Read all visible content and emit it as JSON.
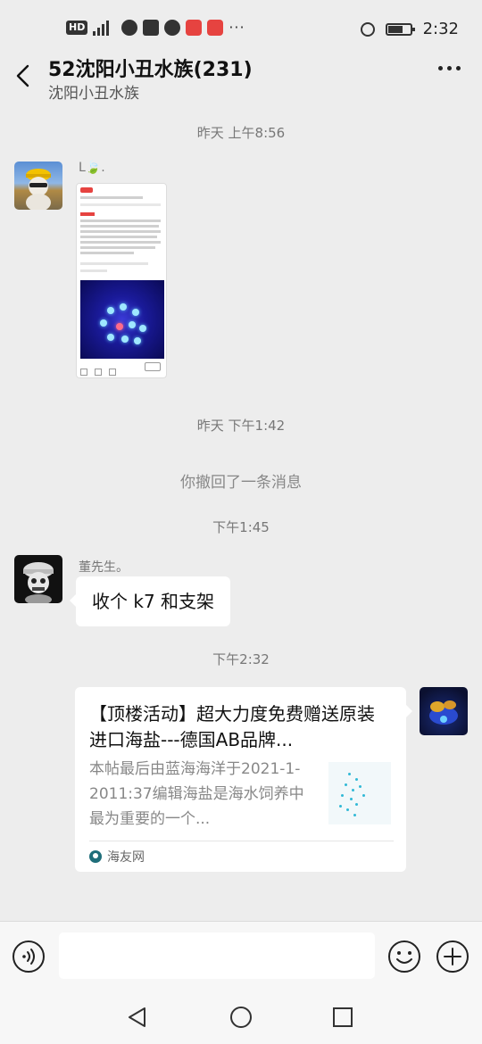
{
  "status_bar": {
    "time": "2:32",
    "network_label": "HD",
    "network_type": "4G"
  },
  "header": {
    "title": "52沈阳小丑水族(231)",
    "subtitle": "沈阳小丑水族"
  },
  "messages": {
    "time1": "昨天 上午8:56",
    "sender1": "L🍃.",
    "time2": "昨天 下午1:42",
    "recall": "你撤回了一条消息",
    "time3": "下午1:45",
    "sender2": "董先生。",
    "text2": "收个 k7 和支架",
    "time4": "下午2:32",
    "link_card": {
      "title": "【顶楼活动】超大力度免费赠送原装进口海盐---德国AB品牌...",
      "description": "本帖最后由蓝海海洋于2021-1-2011:37编辑海盐是海水饲养中最为重要的一个...",
      "source": "海友网"
    }
  },
  "input": {
    "value": "",
    "placeholder": ""
  },
  "icons": {
    "back": "chevron-left-icon",
    "more": "more-icon",
    "voice": "voice-icon",
    "emoji": "emoji-icon",
    "plus": "plus-icon"
  }
}
